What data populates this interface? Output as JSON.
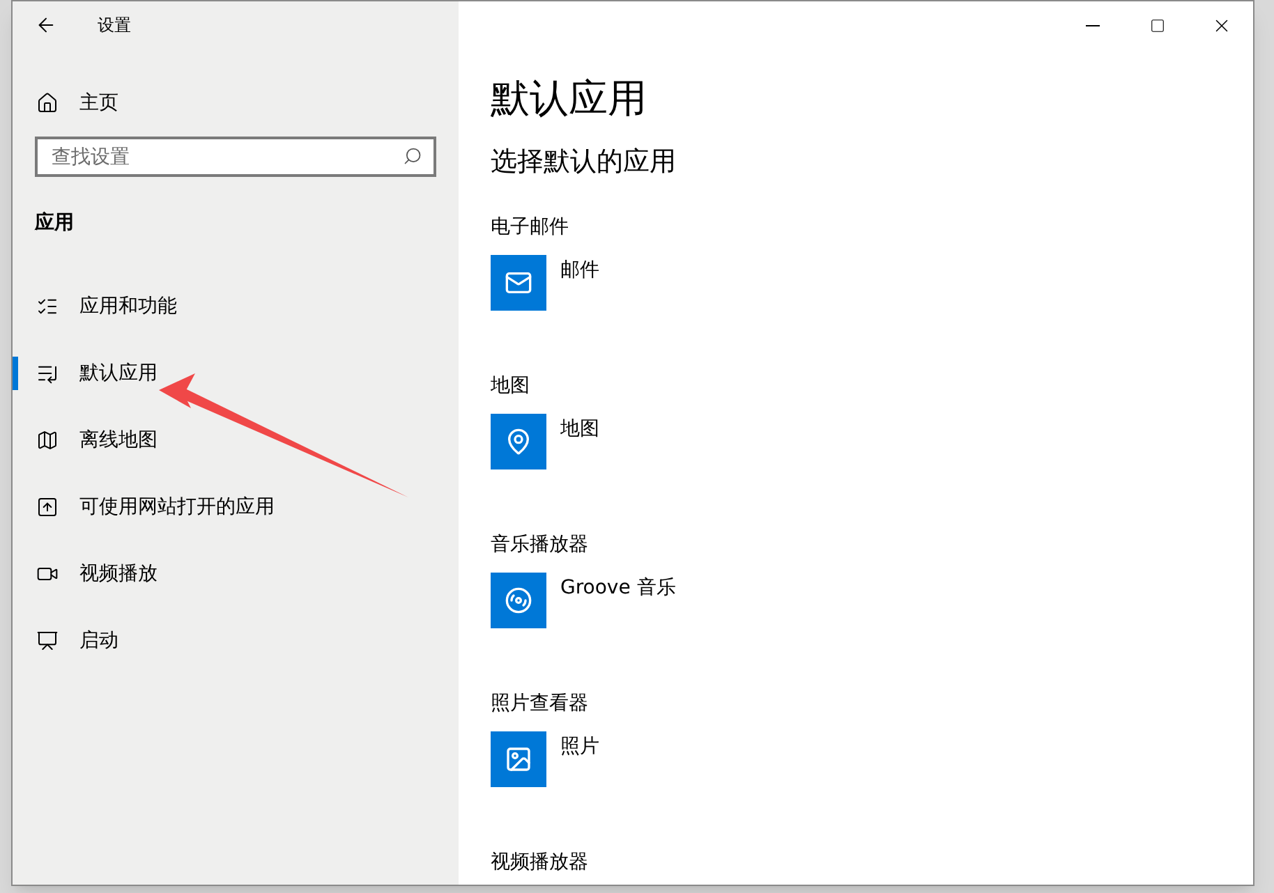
{
  "window": {
    "title": "设置"
  },
  "sidebar": {
    "home": "主页",
    "search": {
      "placeholder": "查找设置"
    },
    "section": "应用",
    "items": [
      {
        "label": "应用和功能",
        "kind": "list",
        "selected": false
      },
      {
        "label": "默认应用",
        "kind": "defaults",
        "selected": true
      },
      {
        "label": "离线地图",
        "kind": "map",
        "selected": false
      },
      {
        "label": "可使用网站打开的应用",
        "kind": "web",
        "selected": false
      },
      {
        "label": "视频播放",
        "kind": "video",
        "selected": false
      },
      {
        "label": "启动",
        "kind": "startup",
        "selected": false
      }
    ]
  },
  "content": {
    "title": "默认应用",
    "subtitle": "选择默认的应用",
    "groups": [
      {
        "label": "电子邮件",
        "app": "邮件",
        "kind": "mail"
      },
      {
        "label": "地图",
        "app": "地图",
        "kind": "maps"
      },
      {
        "label": "音乐播放器",
        "app": "Groove 音乐",
        "kind": "music"
      },
      {
        "label": "照片查看器",
        "app": "照片",
        "kind": "photos"
      },
      {
        "label": "视频播放器"
      }
    ]
  }
}
